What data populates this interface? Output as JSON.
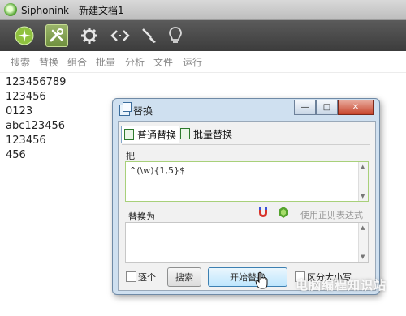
{
  "window": {
    "title": "Siphonink - 新建文档1"
  },
  "toolbar": {
    "buttons": [
      {
        "icon": "sparkle-logo-icon"
      },
      {
        "icon": "tools-icon",
        "active": true
      },
      {
        "icon": "gear-icon"
      },
      {
        "icon": "code-arrows-icon"
      },
      {
        "icon": "brush-icon"
      },
      {
        "icon": "lightbulb-icon"
      }
    ]
  },
  "menu": [
    "搜索",
    "替换",
    "组合",
    "批量",
    "分析",
    "文件",
    "运行"
  ],
  "editor": {
    "lines": [
      "123456789",
      "123456",
      "0123",
      "abc123456",
      "123456",
      "456"
    ]
  },
  "dialog": {
    "title": "替换",
    "window_buttons": [
      "minimize",
      "maximize",
      "close"
    ],
    "tabs": [
      "普通替换",
      "批量替换"
    ],
    "find_label": "把",
    "find_value": "^(\\w){1,5}$",
    "replace_label": "替换为",
    "regex_label": "使用正则表达式",
    "one_by_one_label": "逐个",
    "search_button": "搜索",
    "start_button": "开始替换",
    "case_label": "区分大小写"
  },
  "watermark": "电脑编程知识站",
  "colors": {
    "toolbar_bg": "#4a4a4a",
    "dialog_frame": "#cfe0f0",
    "accent_green": "#7fa045"
  }
}
